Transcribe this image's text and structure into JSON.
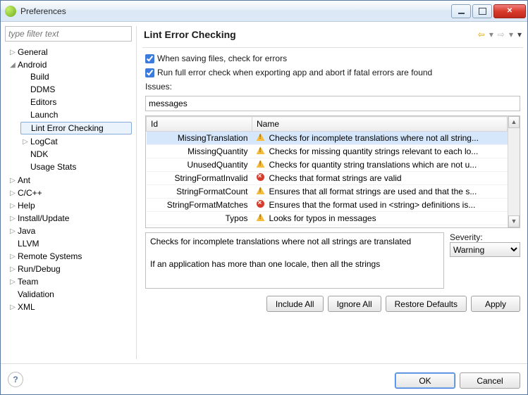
{
  "window": {
    "title": "Preferences"
  },
  "filter": {
    "placeholder": "type filter text"
  },
  "tree": {
    "general": "General",
    "android": "Android",
    "android_children": {
      "build": "Build",
      "ddms": "DDMS",
      "editors": "Editors",
      "launch": "Launch",
      "lint": "Lint Error Checking",
      "logcat": "LogCat",
      "ndk": "NDK",
      "usage": "Usage Stats"
    },
    "ant": "Ant",
    "cpp": "C/C++",
    "help": "Help",
    "install": "Install/Update",
    "java": "Java",
    "llvm": "LLVM",
    "remote": "Remote Systems",
    "rundebug": "Run/Debug",
    "team": "Team",
    "validation": "Validation",
    "xml": "XML"
  },
  "page": {
    "title": "Lint Error Checking",
    "check_on_save": "When saving files, check for errors",
    "check_on_export": "Run full error check when exporting app and abort if fatal errors are found",
    "issues_label": "Issues:",
    "search_value": "messages",
    "cols": {
      "id": "Id",
      "name": "Name"
    },
    "rows": [
      {
        "id": "MissingTranslation",
        "sev": "warn",
        "name": "Checks for incomplete translations where not all string...",
        "selected": true
      },
      {
        "id": "MissingQuantity",
        "sev": "warn",
        "name": "Checks for missing quantity strings relevant to each lo..."
      },
      {
        "id": "UnusedQuantity",
        "sev": "warn",
        "name": "Checks for quantity string translations which are not u..."
      },
      {
        "id": "StringFormatInvalid",
        "sev": "err",
        "name": "Checks that format strings are valid"
      },
      {
        "id": "StringFormatCount",
        "sev": "warn",
        "name": "Ensures that all format strings are used and that the s..."
      },
      {
        "id": "StringFormatMatches",
        "sev": "err",
        "name": "Ensures that the format used in <string> definitions is..."
      },
      {
        "id": "Typos",
        "sev": "warn",
        "name": "Looks for typos in messages"
      }
    ],
    "detail_line1": "Checks for incomplete translations where not all strings are translated",
    "detail_line2": "If an application has more than one locale, then all the strings",
    "severity_label": "Severity:",
    "severity_value": "Warning",
    "buttons": {
      "include_all": "Include All",
      "ignore_all": "Ignore All",
      "restore": "Restore Defaults",
      "apply": "Apply",
      "ok": "OK",
      "cancel": "Cancel"
    }
  }
}
